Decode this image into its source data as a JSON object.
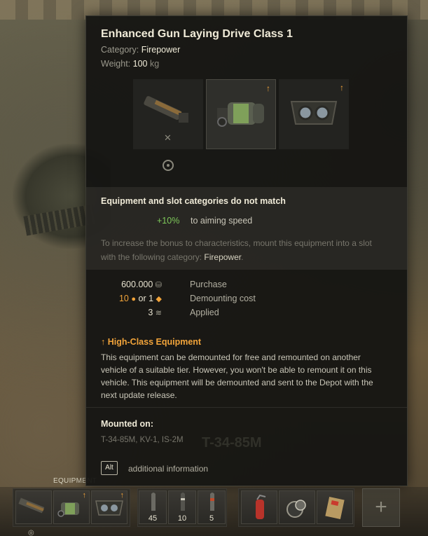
{
  "tooltip": {
    "title": "Enhanced Gun Laying Drive Class 1",
    "category_label": "Category:",
    "category_value": "Firepower",
    "weight_label": "Weight:",
    "weight_value": "100",
    "weight_unit": "kg",
    "mismatch_title": "Equipment and slot categories do not match",
    "bonus_value": "+10%",
    "bonus_text": "to aiming speed",
    "hint_prefix": "To increase the bonus to characteristics, mount this equipment into a slot with the following category:",
    "hint_category": "Firepower",
    "hint_suffix": ".",
    "prices": [
      {
        "value": "600.000",
        "label": "Purchase"
      },
      {
        "value_gold": "10",
        "or": "or 1",
        "label": "Demounting cost"
      },
      {
        "value": "3",
        "label": "Applied"
      }
    ],
    "high_class_title": "High-Class Equipment",
    "high_class_text": "This equipment can be demounted for free and remounted on another vehicle of a suitable tier. However, you won't be able to remount it on this vehicle. This equipment will be demounted and sent to the Depot with the next update release.",
    "mounted_title": "Mounted on:",
    "mounted_list": "T-34-85M, KV-1, IS-2M",
    "ghost_text": "T-34-85M",
    "alt_key": "Alt",
    "alt_info": "additional information"
  },
  "background": {
    "equipment_label": "EQUIPMENT"
  },
  "ammo": [
    {
      "count": "45"
    },
    {
      "count": "10"
    },
    {
      "count": "5"
    }
  ],
  "colors": {
    "accent_orange": "#f2a43a",
    "bonus_green": "#7ec95a"
  },
  "icons": {
    "upgrade": "upgrade-arrow-icon",
    "credits": "credits-icon",
    "gold": "gold-icon",
    "bonds": "bonds-icon",
    "applied": "applied-icon"
  }
}
